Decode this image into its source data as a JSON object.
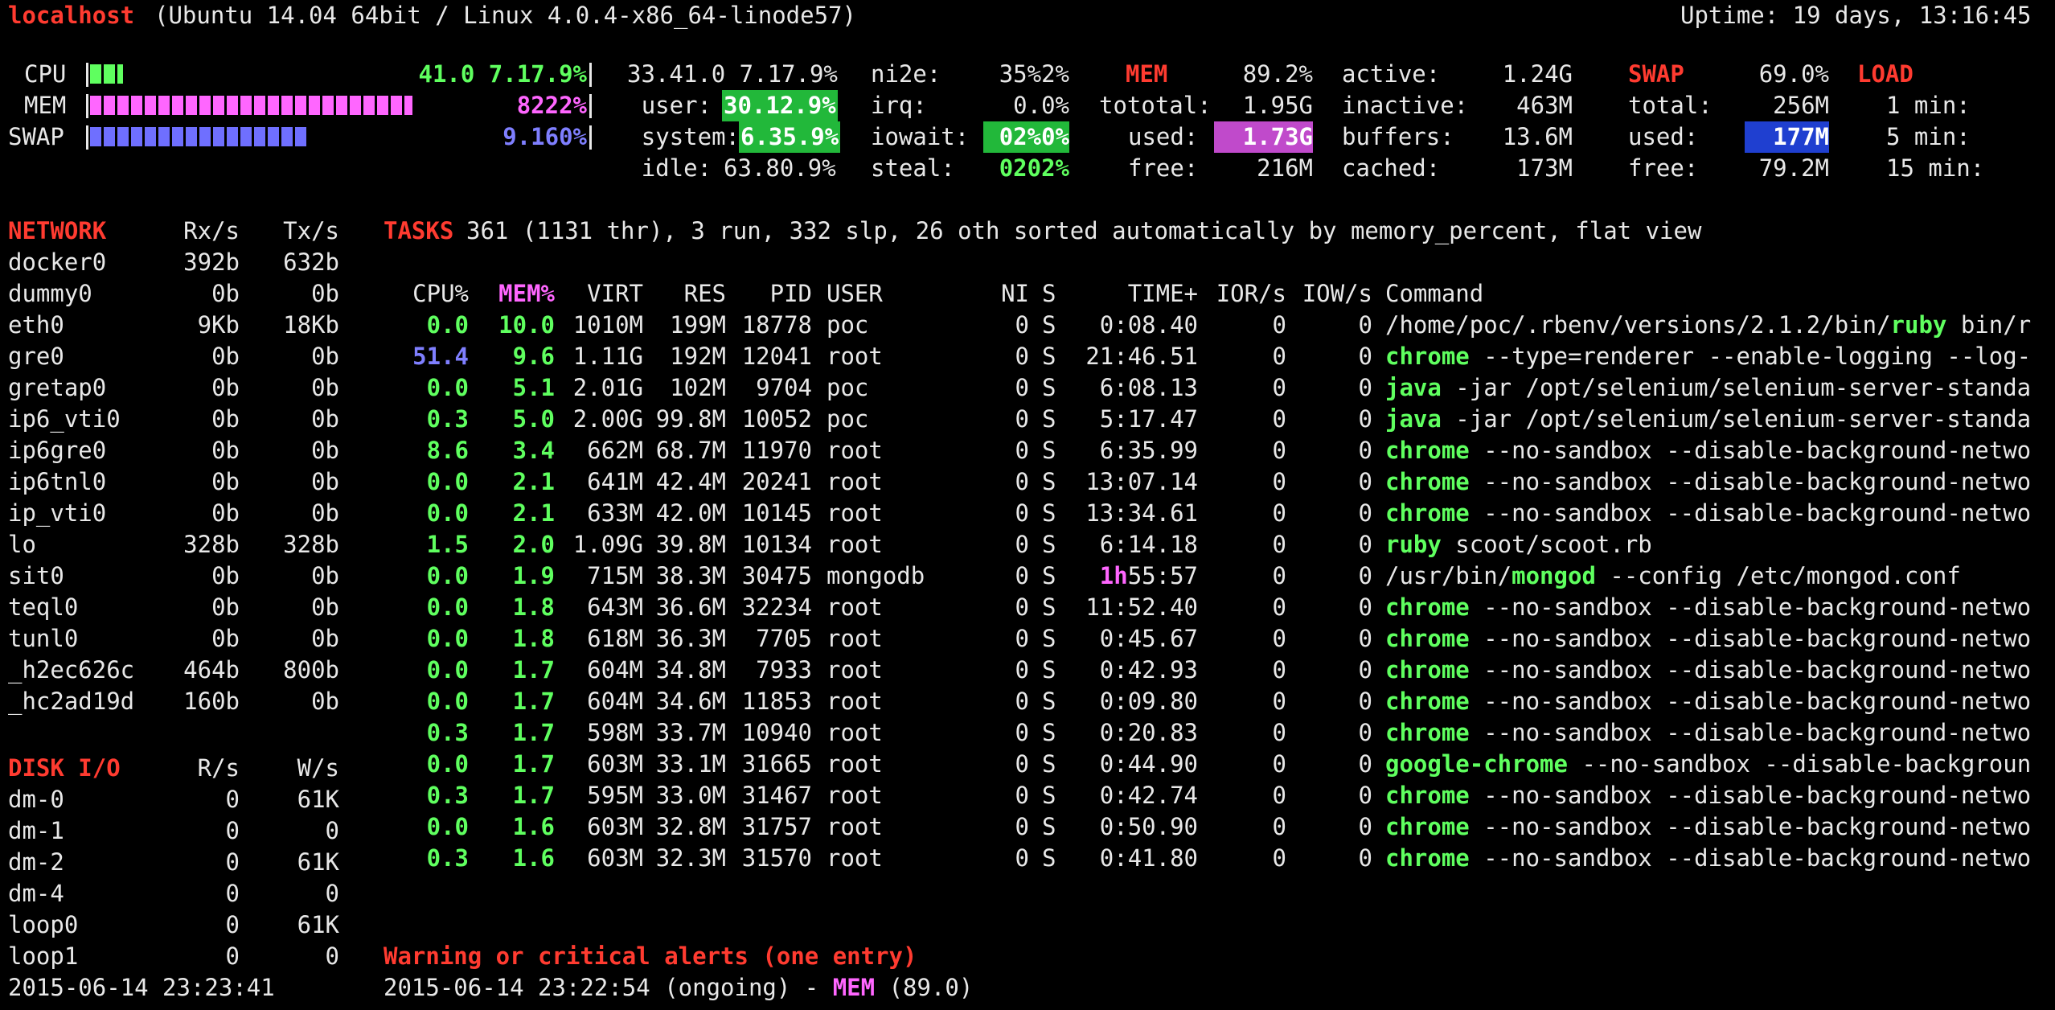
{
  "header": {
    "host": "localhost",
    "system": "(Ubuntu 14.04 64bit / Linux 4.0.4-x86_64-linode57)",
    "uptime": "Uptime: 19 days, 13:16:45"
  },
  "quicklook": {
    "cpu_label": "CPU",
    "cpu_value": "41.0 7.17.9%",
    "cpu_fraction": 0.41,
    "mem_label": "MEM",
    "mem_value": "8222%",
    "mem_fraction": 0.892,
    "swap_label": "SWAP",
    "swap_value": "9.160%",
    "swap_fraction": 0.69
  },
  "cpu": {
    "total": "33.41.0 7.17.9%",
    "user_label": "user:",
    "user_value": "30.12.9%",
    "system_label": "system:",
    "system_value": "6.35.9%",
    "idle_label": "idle:",
    "idle_value": "63.80.9%",
    "nice_label": "ni2e:",
    "nice_value": "35%2%",
    "irq_label": "irq:",
    "irq_value": "0.0%",
    "iowait_label": "iowait:",
    "iowait_value": "02%0%",
    "steal_label": "steal:",
    "steal_value": "0202%"
  },
  "mem": {
    "title": "MEM",
    "percent": "89.2%",
    "total_label": "tototal:",
    "total_value": "1.95G",
    "used_label": "used:",
    "used_value": "1.73G",
    "free_label": "free:",
    "free_value": "216M",
    "active_label": "active:",
    "active_value": "1.24G",
    "inactive_label": "inactive:",
    "inactive_value": "463M",
    "buffers_label": "buffers:",
    "buffers_value": "13.6M",
    "cached_label": "cached:",
    "cached_value": "173M"
  },
  "swap": {
    "title": "SWAP",
    "percent": "69.0%",
    "total_label": "total:",
    "total_value": "256M",
    "used_label": "used:",
    "used_value": "177M",
    "free_label": "free:",
    "free_value": "79.2M"
  },
  "load": {
    "title": "LOAD",
    "m1": "1 min:",
    "m5": "5 min:",
    "m15": "15 min:"
  },
  "network": {
    "title": "NETWORK",
    "rx": "Rx/s",
    "tx": "Tx/s",
    "rows": [
      [
        "docker0",
        "392b",
        "632b"
      ],
      [
        "dummy0",
        "0b",
        "0b"
      ],
      [
        "eth0",
        "9Kb",
        "18Kb"
      ],
      [
        "gre0",
        "0b",
        "0b"
      ],
      [
        "gretap0",
        "0b",
        "0b"
      ],
      [
        "ip6_vti0",
        "0b",
        "0b"
      ],
      [
        "ip6gre0",
        "0b",
        "0b"
      ],
      [
        "ip6tnl0",
        "0b",
        "0b"
      ],
      [
        "ip_vti0",
        "0b",
        "0b"
      ],
      [
        "lo",
        "328b",
        "328b"
      ],
      [
        "sit0",
        "0b",
        "0b"
      ],
      [
        "teql0",
        "0b",
        "0b"
      ],
      [
        "tunl0",
        "0b",
        "0b"
      ],
      [
        "_h2ec626c",
        "464b",
        "800b"
      ],
      [
        "_hc2ad19d",
        "160b",
        "0b"
      ]
    ]
  },
  "disk": {
    "title": "DISK I/O",
    "r": "R/s",
    "w": "W/s",
    "rows": [
      [
        "dm-0",
        "0",
        "61K"
      ],
      [
        "dm-1",
        "0",
        "0"
      ],
      [
        "dm-2",
        "0",
        "61K"
      ],
      [
        "dm-4",
        "0",
        "0"
      ],
      [
        "loop0",
        "0",
        "61K"
      ],
      [
        "loop1",
        "0",
        "0"
      ]
    ]
  },
  "tasks": {
    "title": "TASKS",
    "summary": "361 (1131 thr), 3 run, 332 slp, 26 oth sorted automatically by memory_percent, flat view",
    "headers": {
      "cpu": "CPU%",
      "mem": "MEM%",
      "virt": "VIRT",
      "res": "RES",
      "pid": "PID",
      "user": "USER",
      "ni": "NI",
      "s": "S",
      "time": "TIME+",
      "ior": "IOR/s",
      "iow": "IOW/s",
      "cmd": "Command"
    },
    "rows": [
      {
        "cpu": "0.0",
        "mem": "10.0",
        "virt": "1010M",
        "res": "199M",
        "pid": "18778",
        "user": "poc",
        "ni": "0",
        "s": "S",
        "time": "0:08.40",
        "ior": "0",
        "iow": "0",
        "cmd_pre": "/home/poc/.rbenv/versions/2.1.2/bin/",
        "cmd_bold": "ruby",
        "cmd_rest": " bin/r"
      },
      {
        "cpu": "51.4",
        "mem": "9.6",
        "virt": "1.11G",
        "res": "192M",
        "pid": "12041",
        "user": "root",
        "ni": "0",
        "s": "S",
        "time": "21:46.51",
        "ior": "0",
        "iow": "0",
        "cmd_pre": "",
        "cmd_bold": "chrome",
        "cmd_rest": " --type=renderer --enable-logging --log-"
      },
      {
        "cpu": "0.0",
        "mem": "5.1",
        "virt": "2.01G",
        "res": "102M",
        "pid": "9704",
        "user": "poc",
        "ni": "0",
        "s": "S",
        "time": "6:08.13",
        "ior": "0",
        "iow": "0",
        "cmd_pre": "",
        "cmd_bold": "java",
        "cmd_rest": " -jar /opt/selenium/selenium-server-standa"
      },
      {
        "cpu": "0.3",
        "mem": "5.0",
        "virt": "2.00G",
        "res": "99.8M",
        "pid": "10052",
        "user": "poc",
        "ni": "0",
        "s": "S",
        "time": "5:17.47",
        "ior": "0",
        "iow": "0",
        "cmd_pre": "",
        "cmd_bold": "java",
        "cmd_rest": " -jar /opt/selenium/selenium-server-standa"
      },
      {
        "cpu": "8.6",
        "mem": "3.4",
        "virt": "662M",
        "res": "68.7M",
        "pid": "11970",
        "user": "root",
        "ni": "0",
        "s": "S",
        "time": "6:35.99",
        "ior": "0",
        "iow": "0",
        "cmd_pre": "",
        "cmd_bold": "chrome",
        "cmd_rest": " --no-sandbox --disable-background-netwo"
      },
      {
        "cpu": "0.0",
        "mem": "2.1",
        "virt": "641M",
        "res": "42.4M",
        "pid": "20241",
        "user": "root",
        "ni": "0",
        "s": "S",
        "time": "13:07.14",
        "ior": "0",
        "iow": "0",
        "cmd_pre": "",
        "cmd_bold": "chrome",
        "cmd_rest": " --no-sandbox --disable-background-netwo"
      },
      {
        "cpu": "0.0",
        "mem": "2.1",
        "virt": "633M",
        "res": "42.0M",
        "pid": "10145",
        "user": "root",
        "ni": "0",
        "s": "S",
        "time": "13:34.61",
        "ior": "0",
        "iow": "0",
        "cmd_pre": "",
        "cmd_bold": "chrome",
        "cmd_rest": " --no-sandbox --disable-background-netwo"
      },
      {
        "cpu": "1.5",
        "mem": "2.0",
        "virt": "1.09G",
        "res": "39.8M",
        "pid": "10134",
        "user": "root",
        "ni": "0",
        "s": "S",
        "time": "6:14.18",
        "ior": "0",
        "iow": "0",
        "cmd_pre": "",
        "cmd_bold": "ruby",
        "cmd_rest": " scoot/scoot.rb"
      },
      {
        "cpu": "0.0",
        "mem": "1.9",
        "virt": "715M",
        "res": "38.3M",
        "pid": "30475",
        "user": "mongodb",
        "ni": "0",
        "s": "S",
        "time_hl": "1h",
        "time": "55:57",
        "ior": "0",
        "iow": "0",
        "cmd_pre": "/usr/bin/",
        "cmd_bold": "mongod",
        "cmd_rest": " --config /etc/mongod.conf"
      },
      {
        "cpu": "0.0",
        "mem": "1.8",
        "virt": "643M",
        "res": "36.6M",
        "pid": "32234",
        "user": "root",
        "ni": "0",
        "s": "S",
        "time": "11:52.40",
        "ior": "0",
        "iow": "0",
        "cmd_pre": "",
        "cmd_bold": "chrome",
        "cmd_rest": " --no-sandbox --disable-background-netwo"
      },
      {
        "cpu": "0.0",
        "mem": "1.8",
        "virt": "618M",
        "res": "36.3M",
        "pid": "7705",
        "user": "root",
        "ni": "0",
        "s": "S",
        "time": "0:45.67",
        "ior": "0",
        "iow": "0",
        "cmd_pre": "",
        "cmd_bold": "chrome",
        "cmd_rest": " --no-sandbox --disable-background-netwo"
      },
      {
        "cpu": "0.0",
        "mem": "1.7",
        "virt": "604M",
        "res": "34.8M",
        "pid": "7933",
        "user": "root",
        "ni": "0",
        "s": "S",
        "time": "0:42.93",
        "ior": "0",
        "iow": "0",
        "cmd_pre": "",
        "cmd_bold": "chrome",
        "cmd_rest": " --no-sandbox --disable-background-netwo"
      },
      {
        "cpu": "0.0",
        "mem": "1.7",
        "virt": "604M",
        "res": "34.6M",
        "pid": "11853",
        "user": "root",
        "ni": "0",
        "s": "S",
        "time": "0:09.80",
        "ior": "0",
        "iow": "0",
        "cmd_pre": "",
        "cmd_bold": "chrome",
        "cmd_rest": " --no-sandbox --disable-background-netwo"
      },
      {
        "cpu": "0.3",
        "mem": "1.7",
        "virt": "598M",
        "res": "33.7M",
        "pid": "10940",
        "user": "root",
        "ni": "0",
        "s": "S",
        "time": "0:20.83",
        "ior": "0",
        "iow": "0",
        "cmd_pre": "",
        "cmd_bold": "chrome",
        "cmd_rest": " --no-sandbox --disable-background-netwo"
      },
      {
        "cpu": "0.0",
        "mem": "1.7",
        "virt": "603M",
        "res": "33.1M",
        "pid": "31665",
        "user": "root",
        "ni": "0",
        "s": "S",
        "time": "0:44.90",
        "ior": "0",
        "iow": "0",
        "cmd_pre": "",
        "cmd_bold": "google-chrome",
        "cmd_rest": " --no-sandbox --disable-backgroun"
      },
      {
        "cpu": "0.3",
        "mem": "1.7",
        "virt": "595M",
        "res": "33.0M",
        "pid": "31467",
        "user": "root",
        "ni": "0",
        "s": "S",
        "time": "0:42.74",
        "ior": "0",
        "iow": "0",
        "cmd_pre": "",
        "cmd_bold": "chrome",
        "cmd_rest": " --no-sandbox --disable-background-netwo"
      },
      {
        "cpu": "0.0",
        "mem": "1.6",
        "virt": "603M",
        "res": "32.8M",
        "pid": "31757",
        "user": "root",
        "ni": "0",
        "s": "S",
        "time": "0:50.90",
        "ior": "0",
        "iow": "0",
        "cmd_pre": "",
        "cmd_bold": "chrome",
        "cmd_rest": " --no-sandbox --disable-background-netwo"
      },
      {
        "cpu": "0.3",
        "mem": "1.6",
        "virt": "603M",
        "res": "32.3M",
        "pid": "31570",
        "user": "root",
        "ni": "0",
        "s": "S",
        "time": "0:41.80",
        "ior": "0",
        "iow": "0",
        "cmd_pre": "",
        "cmd_bold": "chrome",
        "cmd_rest": " --no-sandbox --disable-background-netwo"
      }
    ]
  },
  "alerts": {
    "title": "Warning or critical alerts (one entry)",
    "entry_pre": "2015-06-14 23:22:54 (ongoing) - ",
    "entry_key": "MEM",
    "entry_post": " (89.0)"
  },
  "footer": {
    "datetime": "2015-06-14 23:23:41"
  },
  "colors": {
    "background": "#000000",
    "text": "#e8e8e8",
    "title_red": "#ff3b30",
    "ok_green": "#5fff5f",
    "careful_pink": "#ff66ff",
    "warning_blue": "#7f7fff",
    "bg_green": "#22b83a",
    "bg_magenta": "#c04acb",
    "bg_blue": "#1f3fd0"
  }
}
